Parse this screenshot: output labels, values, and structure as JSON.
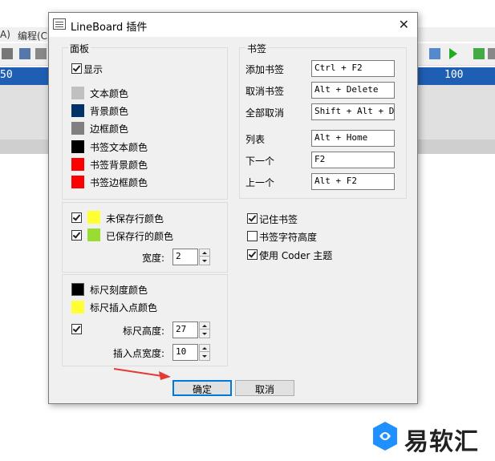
{
  "background": {
    "menu_items": [
      "A)",
      "编程(C)"
    ],
    "ruler_left": "50",
    "ruler_right": "100"
  },
  "dialog": {
    "title": "LineBoard 插件",
    "close_glyph": "✕",
    "panel": {
      "title": "面板",
      "show_label": "显示",
      "show_checked": true,
      "colors": [
        {
          "label": "文本颜色",
          "color": "#c0c0c0"
        },
        {
          "label": "背景颜色",
          "color": "#003366"
        },
        {
          "label": "边框颜色",
          "color": "#808080"
        },
        {
          "label": "书签文本颜色",
          "color": "#000000"
        },
        {
          "label": "书签背景颜色",
          "color": "#ff0000"
        },
        {
          "label": "书签边框颜色",
          "color": "#ff0000"
        }
      ]
    },
    "lines": {
      "unsaved_label": "未保存行颜色",
      "unsaved_color": "#ffff33",
      "unsaved_checked": true,
      "saved_label": "已保存行的颜色",
      "saved_color": "#99dd33",
      "saved_checked": true,
      "width_label": "宽度:",
      "width_value": "2"
    },
    "ruler": {
      "tick_color_label": "标尺刻度颜色",
      "tick_color": "#000000",
      "insert_color_label": "标尺插入点颜色",
      "insert_color": "#ffff33",
      "height_checked": true,
      "height_label": "标尺高度:",
      "height_value": "27",
      "insert_width_label": "插入点宽度:",
      "insert_width_value": "10"
    },
    "bookmarks": {
      "title": "书签",
      "items": [
        {
          "label": "添加书签",
          "value": "Ctrl + F2"
        },
        {
          "label": "取消书签",
          "value": "Alt + Delete"
        },
        {
          "label": "全部取消",
          "value": "Shift + Alt + Del"
        },
        {
          "label": "列表",
          "value": "Alt + Home"
        },
        {
          "label": "下一个",
          "value": "F2"
        },
        {
          "label": "上一个",
          "value": "Alt + F2"
        }
      ]
    },
    "options": [
      {
        "label": "记住书签",
        "checked": true
      },
      {
        "label": "书签字符高度",
        "checked": false
      },
      {
        "label": "使用 Coder 主题",
        "checked": true
      }
    ],
    "ok_label": "确定",
    "cancel_label": "取消"
  },
  "watermark": {
    "text": "易软汇"
  }
}
